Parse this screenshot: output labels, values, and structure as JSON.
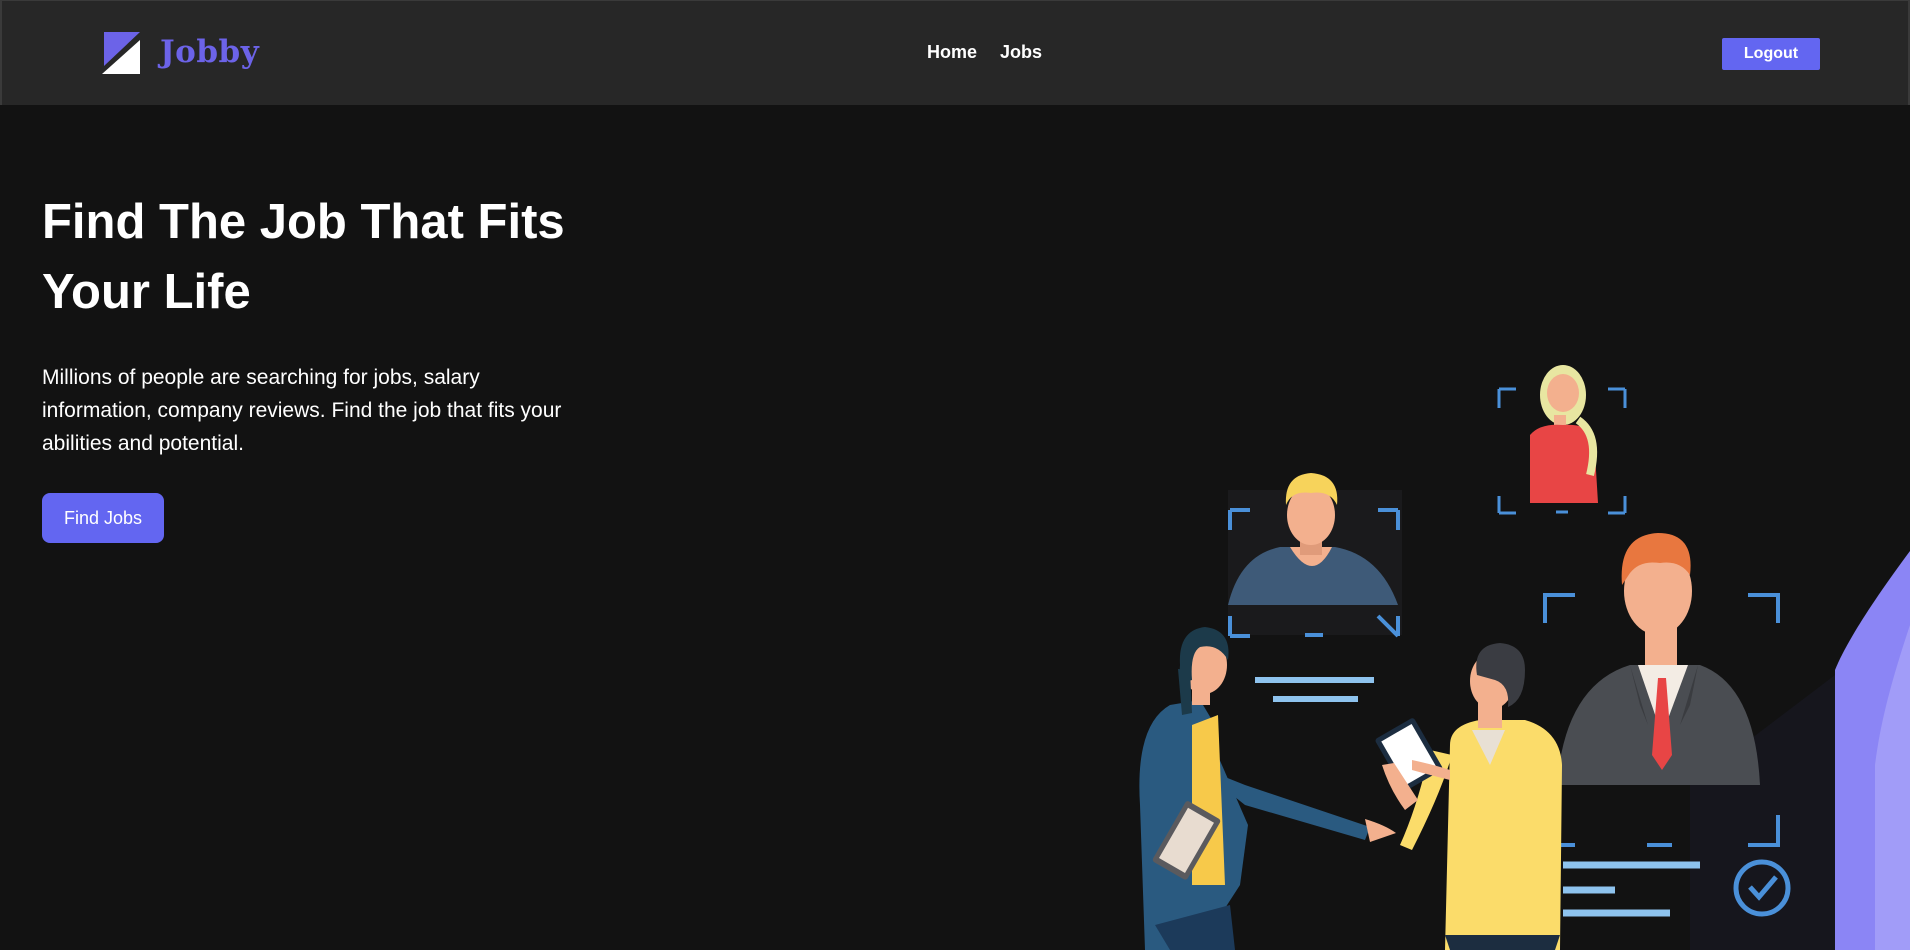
{
  "navbar": {
    "brand_name": "Jobby",
    "links": [
      {
        "label": "Home"
      },
      {
        "label": "Jobs"
      }
    ],
    "logout_label": "Logout"
  },
  "hero": {
    "title_line1": "Find The Job That Fits",
    "title_line2": "Your Life",
    "description": "Millions of people are searching for jobs, salary information, company reviews. Find the job that fits your abilities and potential.",
    "cta_label": "Find Jobs"
  },
  "colors": {
    "accent": "#6366f1",
    "background": "#121212",
    "navbar": "#272727",
    "brand": "#6c63e8"
  },
  "icons": [
    "logo-icon",
    "checkmark-circle-icon"
  ]
}
